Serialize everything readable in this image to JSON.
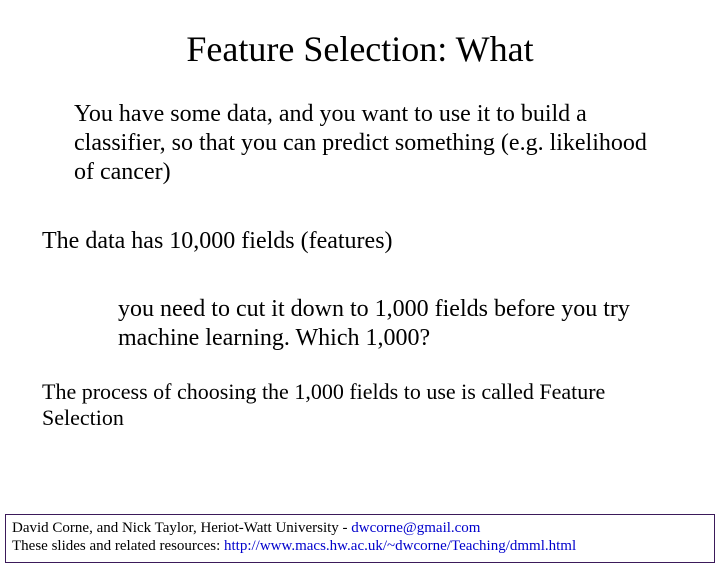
{
  "title": "Feature Selection:  What",
  "para1": "You have some data, and you want to use it to build a classifier, so that you can predict something (e.g. likelihood of cancer)",
  "para2": "The data has 10,000 fields (features)",
  "para3": "you need to cut it down to 1,000 fields before you try machine learning. Which 1,000?",
  "para4": "The process of choosing the 1,000 fields to use is called Feature Selection",
  "footer": {
    "line1_pre": "David Corne, and Nick Taylor,  Heriot-Watt University  -  ",
    "email": "dwcorne@gmail.com",
    "line2_pre": "These slides and related resources:   ",
    "url": "http://www.macs.hw.ac.uk/~dwcorne/Teaching/dmml.html"
  }
}
